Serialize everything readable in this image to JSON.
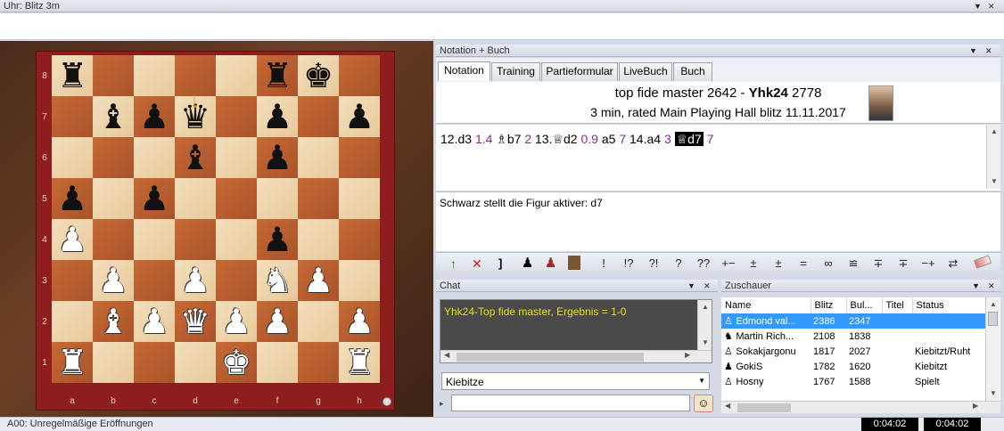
{
  "top": {
    "title": "Uhr: Blitz 3m"
  },
  "panels": {
    "notation_title": "Notation + Buch",
    "chat_title": "Chat",
    "spectators_title": "Zuschauer"
  },
  "tabs": [
    "Notation",
    "Training",
    "Partieformular",
    "LiveBuch",
    "Buch"
  ],
  "game": {
    "white": "top fide master",
    "white_elo": "2642",
    "black": "Yhk24",
    "black_elo": "2778",
    "line2": "3 min, rated Main Playing Hall blitz 11.11.2017",
    "dash": "-"
  },
  "moves": {
    "m1": "12.d3",
    "e1": "1.4",
    "m2": "♗b7",
    "e2": "2",
    "m3": "13.♕d2",
    "e3": "0.9",
    "m4": "a5",
    "e4": "7",
    "m5": "14.a4",
    "e5": "3",
    "m6": "♕d7",
    "e6": "7"
  },
  "comment": "Schwarz stellt die Figur aktiver: d7",
  "annotation_symbols": [
    "!",
    "!?",
    "?!",
    "?",
    "??",
    "+−",
    "±",
    "±",
    "=",
    "∞",
    "≌",
    "∓",
    "∓",
    "−+",
    "⇄"
  ],
  "chat": {
    "message": "Yhk24-Top fide master, Ergebnis = 1-0",
    "target": "Kiebitze",
    "prompt": "▸"
  },
  "spectators": {
    "columns": [
      "Name",
      "Blitz",
      "Bul...",
      "Titel",
      "Status"
    ],
    "rows": [
      {
        "name": "Edmond val...",
        "blitz": "2386",
        "bullet": "2347",
        "title": "",
        "status": ""
      },
      {
        "name": "Martin Rich...",
        "blitz": "2108",
        "bullet": "1838",
        "title": "",
        "status": ""
      },
      {
        "name": "Sokakjargonu",
        "blitz": "1817",
        "bullet": "2027",
        "title": "",
        "status": "Kiebitzt/Ruht"
      },
      {
        "name": "GokiS",
        "blitz": "1782",
        "bullet": "1620",
        "title": "",
        "status": "Kiebitzt"
      },
      {
        "name": "Hosny",
        "blitz": "1767",
        "bullet": "1588",
        "title": "",
        "status": "Spielt"
      }
    ]
  },
  "status": {
    "opening": "A00: Unregelmäßige Eröffnungen",
    "clock_white": "0:04:02",
    "clock_black": "0:04:02"
  },
  "board": {
    "ranks": [
      "8",
      "7",
      "6",
      "5",
      "4",
      "3",
      "2",
      "1"
    ],
    "files": [
      "a",
      "b",
      "c",
      "d",
      "e",
      "f",
      "g",
      "h"
    ],
    "pieces": [
      [
        "br",
        "",
        "",
        "",
        "",
        "br",
        "bk",
        ""
      ],
      [
        "",
        "bb",
        "bp",
        "bq",
        "",
        "bp",
        "",
        "bp"
      ],
      [
        "",
        "",
        "",
        "bb",
        "",
        "bp",
        "",
        ""
      ],
      [
        "bp",
        "",
        "bp",
        "",
        "",
        "",
        "",
        ""
      ],
      [
        "wp",
        "",
        "",
        "",
        "",
        "bp",
        "",
        ""
      ],
      [
        "",
        "wp",
        "",
        "wp",
        "",
        "wn",
        "wp",
        ""
      ],
      [
        "",
        "wb",
        "wp",
        "wq",
        "wp",
        "wp",
        "",
        "wp"
      ],
      [
        "wr",
        "",
        "",
        "",
        "wk",
        "",
        "",
        "wr"
      ]
    ]
  },
  "colors": {
    "accent": "#3399ff",
    "eval": "#8a2a8a",
    "chat_text": "#e8e000"
  }
}
